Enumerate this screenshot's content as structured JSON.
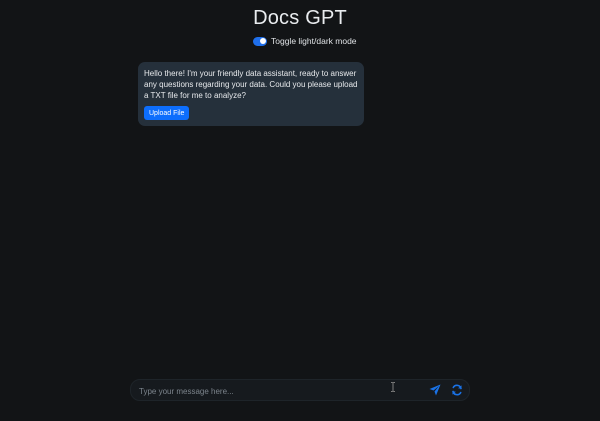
{
  "header": {
    "title": "Docs GPT"
  },
  "theme_toggle": {
    "label": "Toggle light/dark mode",
    "enabled": true
  },
  "chat": {
    "messages": [
      {
        "role": "assistant",
        "text": "Hello there! I'm your friendly data assistant, ready to answer any questions regarding your data. Could you please upload a TXT file for me to analyze?",
        "action_label": "Upload File"
      }
    ]
  },
  "composer": {
    "placeholder": "Type your message here...",
    "value": "",
    "send_icon": "send-icon",
    "refresh_icon": "refresh-icon"
  },
  "colors": {
    "background": "#121416",
    "bubble": "#25303b",
    "accent": "#0d6efd"
  }
}
